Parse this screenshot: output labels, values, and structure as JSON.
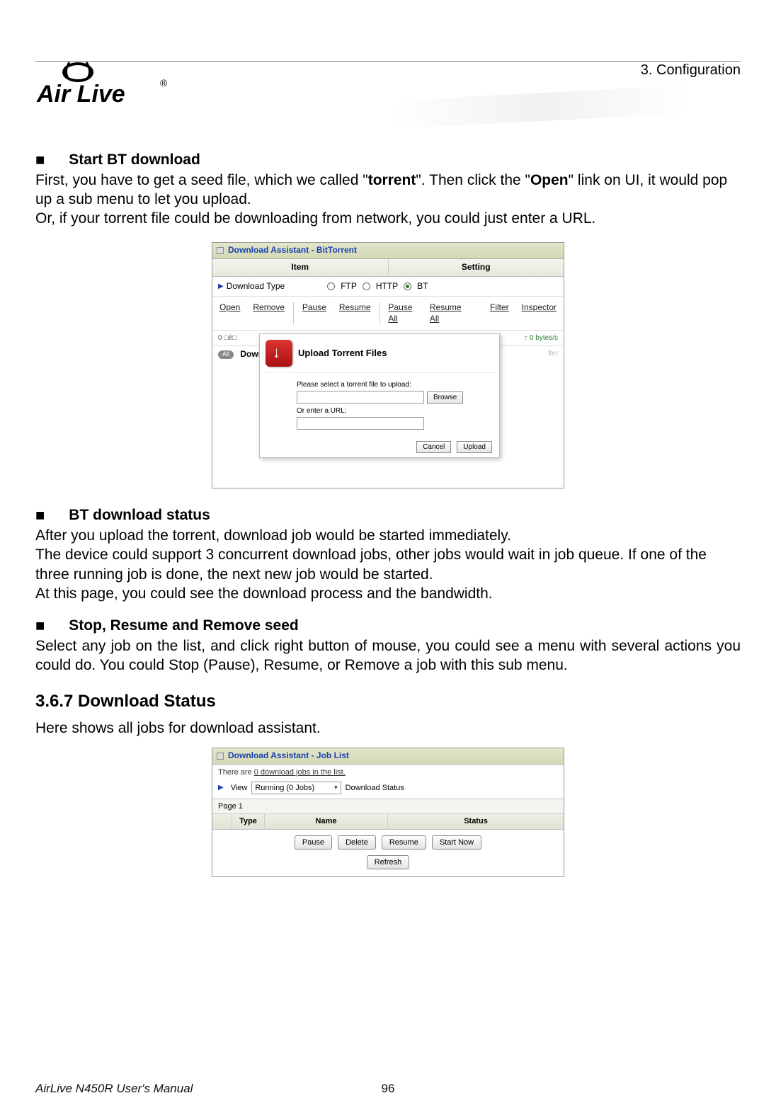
{
  "header": {
    "chapter": "3.  Configuration",
    "brand": "Air Live",
    "reg": "®"
  },
  "sections": {
    "s1": {
      "title": "Start BT download",
      "p1a": "First, you have to get a seed file, which we called \"",
      "p1b": "torrent",
      "p1c": "\". Then click the \"",
      "p1d": "Open",
      "p1e": "\" link on UI, it would pop up a sub menu to let you upload.",
      "p2": "Or, if your torrent file could be downloading from network, you could just enter a URL."
    },
    "s2": {
      "title": "BT download status",
      "p1": "After you upload the torrent, download job would be started immediately.",
      "p2": "The device could support 3 concurrent download jobs, other jobs would wait in job queue. If one of the three running job is done, the next new job would be started.",
      "p3": "At this page, you could see the download process and the bandwidth."
    },
    "s3": {
      "title": "Stop, Resume and Remove seed",
      "p1": "Select any job on the list, and click right button of mouse, you could see a menu with several actions you could do. You could Stop (Pause), Resume, or Remove a job with this sub menu."
    },
    "s4": {
      "title": "3.6.7 Download Status",
      "p1": "Here shows all jobs for download assistant."
    }
  },
  "shot1": {
    "title": "Download Assistant - BitTorrent",
    "col_item": "Item",
    "col_setting": "Setting",
    "row_download_type": "Download Type",
    "radio_ftp": "FTP",
    "radio_http": "HTTP",
    "radio_bt": "BT",
    "selected_radio": "BT",
    "toolbar": {
      "open": "Open",
      "remove": "Remove",
      "pause": "Pause",
      "resume": "Resume",
      "pause_all": "Pause All",
      "resume_all": "Resume All",
      "filter": "Filter",
      "inspector": "Inspector"
    },
    "stats": {
      "left": "0 □é□",
      "right_down": "",
      "right_up": "↑ 0 bytes/s"
    },
    "row2": {
      "all": "All",
      "down_prefix": "Down",
      "faded": "lter"
    },
    "modal": {
      "title": "Upload Torrent Files",
      "lbl1": "Please select a torrent file to upload:",
      "browse": "Browse",
      "lbl2": "Or enter a URL:",
      "cancel": "Cancel",
      "upload": "Upload"
    }
  },
  "shot2": {
    "title": "Download Assistant - Job List",
    "info_a": "There are ",
    "info_b": "0 download jobs in the list.",
    "view": "View",
    "select_value": "Running (0 Jobs)",
    "download_status": "Download Status",
    "page": "Page 1",
    "cols": {
      "type": "Type",
      "name": "Name",
      "status": "Status"
    },
    "btns": {
      "pause": "Pause",
      "delete": "Delete",
      "resume": "Resume",
      "start_now": "Start Now",
      "refresh": "Refresh"
    }
  },
  "footer": {
    "manual": "AirLive N450R User's Manual",
    "page": "96"
  }
}
